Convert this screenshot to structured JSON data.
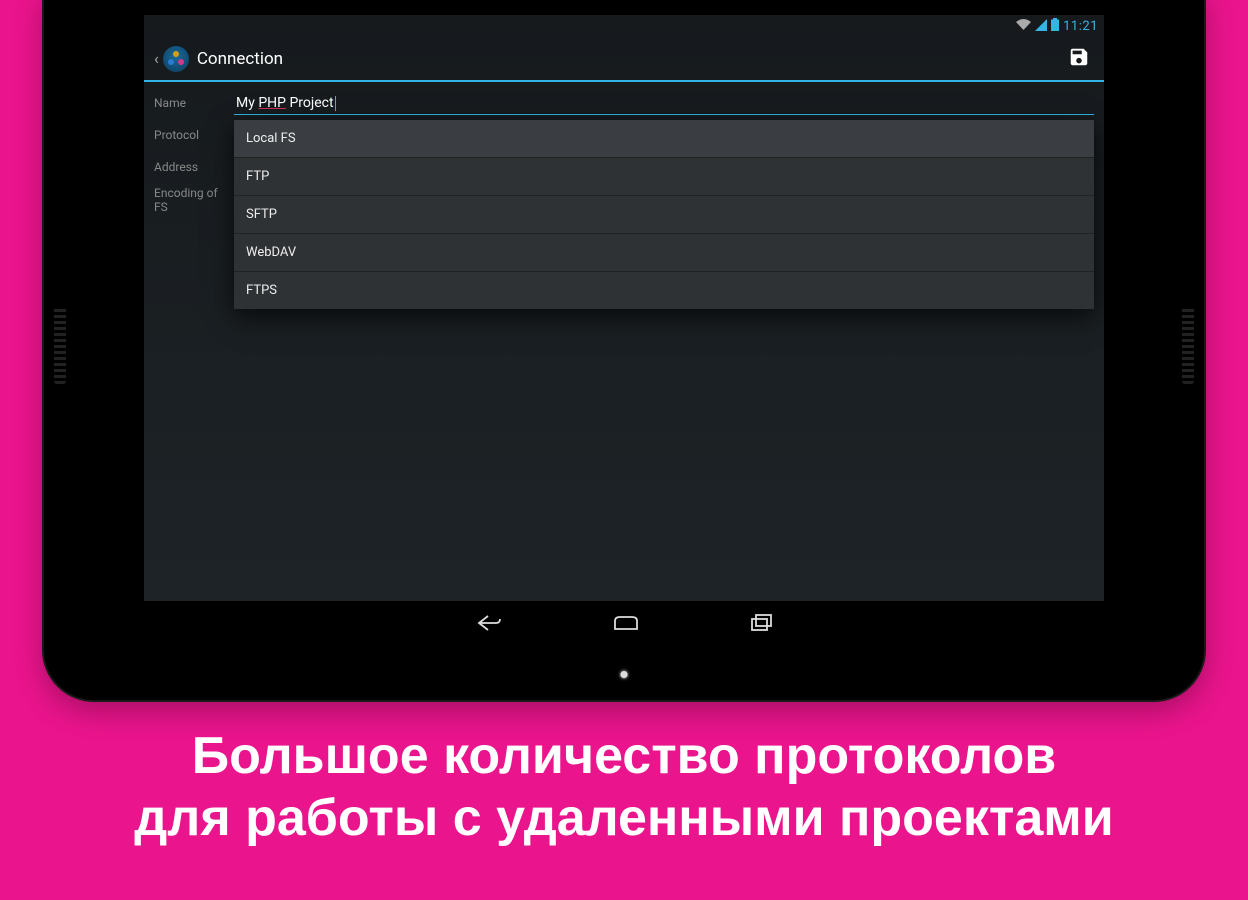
{
  "status": {
    "time": "11:21"
  },
  "actionbar": {
    "title": "Connection"
  },
  "form": {
    "name_label": "Name",
    "name_value_pre": "My ",
    "name_value_underlined": "PHP",
    "name_value_post": " Project",
    "protocol_label": "Protocol",
    "protocol_value": "Local FS",
    "address_label": "Address",
    "address_value": "",
    "encoding_label": "Encoding of FS",
    "encoding_value": "",
    "address_browse": "..."
  },
  "dropdown": {
    "items": [
      "Local FS",
      "FTP",
      "SFTP",
      "WebDAV",
      "FTPS"
    ],
    "selected": 0
  },
  "caption": {
    "line1": "Большое количество протоколов",
    "line2": "для работы с удаленными проектами"
  }
}
